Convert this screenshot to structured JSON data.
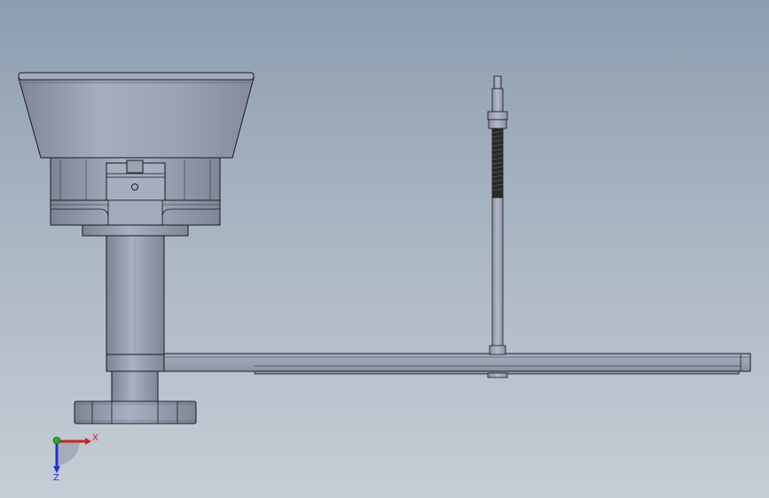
{
  "triad": {
    "x_label": "X",
    "z_label": "Z",
    "x_color": "#cc2222",
    "y_color": "#22aa22",
    "z_color": "#2233cc"
  },
  "colors": {
    "background_top": "#8d9db0",
    "background_bottom": "#c6cdd6",
    "part_fill": "#9ea5b7",
    "part_dark": "#7d8496",
    "edge": "#1a1a1a"
  }
}
